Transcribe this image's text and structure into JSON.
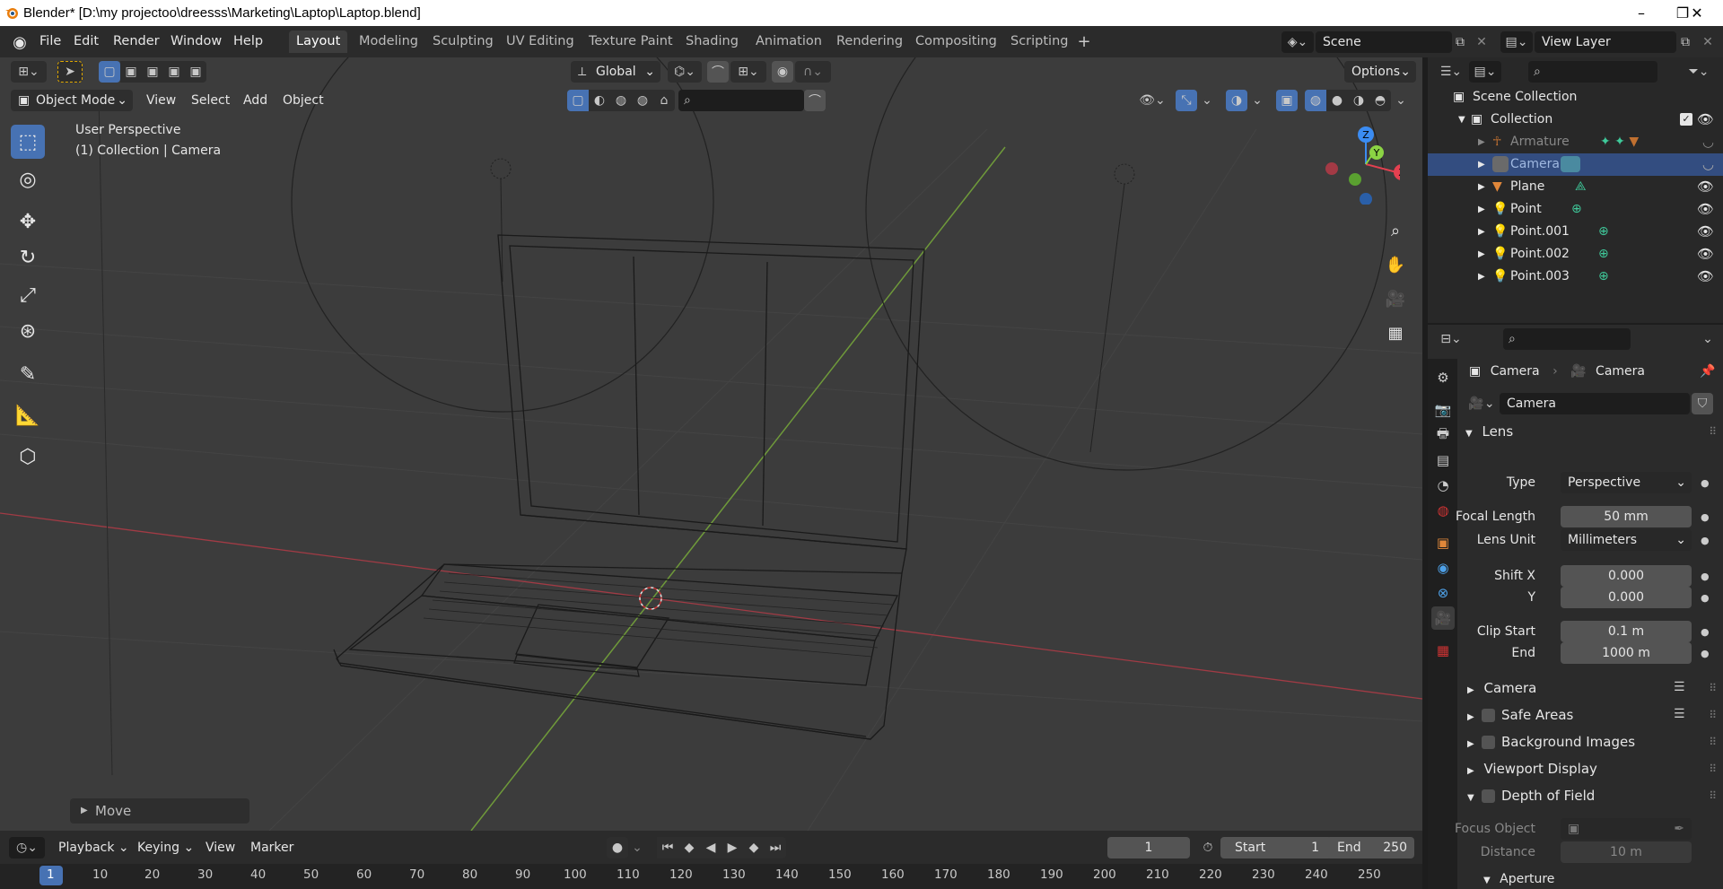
{
  "window": {
    "title": "Blender* [D:\\my projectoo\\dreesss\\Marketing\\Laptop\\Laptop.blend]",
    "controls": [
      "–",
      "❐",
      "✕"
    ]
  },
  "menus": [
    "File",
    "Edit",
    "Render",
    "Window",
    "Help"
  ],
  "workspaces": [
    "Layout",
    "Modeling",
    "Sculpting",
    "UV Editing",
    "Texture Paint",
    "Shading",
    "Animation",
    "Rendering",
    "Compositing",
    "Scripting"
  ],
  "active_workspace": "Layout",
  "scene": {
    "name": "Scene",
    "view_layer": "View Layer"
  },
  "viewport": {
    "transform_orientation": "Global",
    "options_label": "Options",
    "mode": "Object Mode",
    "menus": [
      "View",
      "Select",
      "Add",
      "Object"
    ],
    "overlay_text": [
      "User Perspective",
      "(1) Collection | Camera"
    ],
    "last_operator": "Move",
    "gizmo_axes": [
      "Z",
      "Y",
      "X"
    ]
  },
  "outliner": {
    "root": "Scene Collection",
    "collection": "Collection",
    "items": [
      {
        "name": "Armature",
        "icon": "armature-icon",
        "selected": false,
        "dimmed": true
      },
      {
        "name": "Camera",
        "icon": "camera-icon",
        "selected": true,
        "dimmed": false
      },
      {
        "name": "Plane",
        "icon": "mesh-icon",
        "selected": false,
        "dimmed": false
      },
      {
        "name": "Point",
        "icon": "light-icon",
        "selected": false,
        "dimmed": false
      },
      {
        "name": "Point.001",
        "icon": "light-icon",
        "selected": false,
        "dimmed": false
      },
      {
        "name": "Point.002",
        "icon": "light-icon",
        "selected": false,
        "dimmed": false
      },
      {
        "name": "Point.003",
        "icon": "light-icon",
        "selected": false,
        "dimmed": false
      }
    ]
  },
  "properties": {
    "breadcrumb": [
      "Camera",
      "Camera"
    ],
    "datablock": "Camera",
    "lens": {
      "title": "Lens",
      "type_label": "Type",
      "type_value": "Perspective",
      "focal_label": "Focal Length",
      "focal_value": "50 mm",
      "unit_label": "Lens Unit",
      "unit_value": "Millimeters",
      "shiftx_label": "Shift X",
      "shiftx_value": "0.000",
      "shifty_label": "Y",
      "shifty_value": "0.000",
      "clipstart_label": "Clip Start",
      "clipstart_value": "0.1 m",
      "clipend_label": "End",
      "clipend_value": "1000 m"
    },
    "sections": {
      "camera": "Camera",
      "safe_areas": "Safe Areas",
      "background_images": "Background Images",
      "viewport_display": "Viewport Display",
      "depth_of_field": "Depth of Field",
      "aperture": "Aperture"
    },
    "dof": {
      "focus_label": "Focus Object",
      "distance_label": "Distance",
      "distance_value": "10 m"
    }
  },
  "timeline": {
    "menus": [
      "Playback",
      "Keying",
      "View",
      "Marker"
    ],
    "current_frame": "1",
    "start_label": "Start",
    "start_value": "1",
    "end_label": "End",
    "end_value": "250",
    "ticks": [
      "1",
      "10",
      "20",
      "30",
      "40",
      "50",
      "60",
      "70",
      "80",
      "90",
      "100",
      "110",
      "120",
      "130",
      "140",
      "150",
      "160",
      "170",
      "180",
      "190",
      "200",
      "210",
      "220",
      "230",
      "240",
      "250"
    ]
  },
  "colors": {
    "accent": "#4772b3",
    "selection": "#334d80",
    "x_axis": "#e44050",
    "y_axis": "#8bd344",
    "z_axis": "#3b8cf2",
    "object_orange": "#e0873a",
    "data_green": "#3fc99a"
  }
}
